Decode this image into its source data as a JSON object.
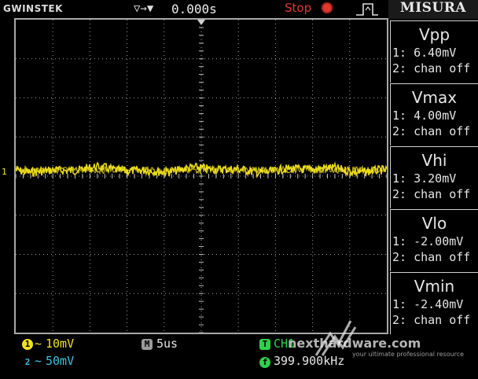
{
  "header": {
    "brand": "GWINSTEK",
    "trigger_glyph": "▽→▼",
    "time_offset": "0.000s",
    "run_status": "Stop",
    "trigger_edge_icon": "rising-edge-icon"
  },
  "measure": {
    "title": "MISURA",
    "items": [
      {
        "name": "Vpp",
        "ch1": "1: 6.40mV",
        "ch2": "2: chan off"
      },
      {
        "name": "Vmax",
        "ch1": "1: 4.00mV",
        "ch2": "2: chan off"
      },
      {
        "name": "Vhi",
        "ch1": "1: 3.20mV",
        "ch2": "2: chan off"
      },
      {
        "name": "Vlo",
        "ch1": "1: -2.00mV",
        "ch2": "2: chan off"
      },
      {
        "name": "Vmin",
        "ch1": "1: -2.40mV",
        "ch2": "2: chan off"
      }
    ]
  },
  "waveform": {
    "channel_marker": "1",
    "colors": {
      "ch1": "#f2e21e",
      "ch2": "#3cc3e4",
      "grid": "#bdbdbd",
      "status": "#e23a2f",
      "info": "#2fd04a"
    }
  },
  "footer": {
    "ch1_badge": "1",
    "ch1_coupling": "~",
    "ch1_scale": "10mV",
    "ch2_badge": "2",
    "ch2_coupling": "~",
    "ch2_scale": "50mV",
    "timebase_badge": "M",
    "timebase": "5us",
    "trigger_badge": "T",
    "trigger_source": "CH1",
    "freq_badge": "f",
    "frequency": "399.900kHz"
  },
  "watermark": {
    "text": "nexthardware.com",
    "subtitle": "your ultimate professional resource"
  }
}
